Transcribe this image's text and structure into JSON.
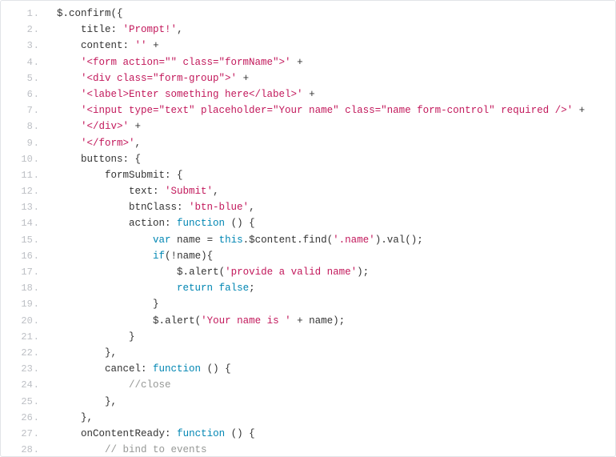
{
  "code": {
    "line_count": 28,
    "lines": [
      {
        "indent": 0,
        "tokens": [
          {
            "c": "pln",
            "t": "$"
          },
          {
            "c": "pun",
            "t": "."
          },
          {
            "c": "pln",
            "t": "confirm"
          },
          {
            "c": "pun",
            "t": "({"
          }
        ]
      },
      {
        "indent": 1,
        "tokens": [
          {
            "c": "key",
            "t": "title"
          },
          {
            "c": "pun",
            "t": ": "
          },
          {
            "c": "str",
            "t": "'Prompt!'"
          },
          {
            "c": "pun",
            "t": ","
          }
        ]
      },
      {
        "indent": 1,
        "tokens": [
          {
            "c": "key",
            "t": "content"
          },
          {
            "c": "pun",
            "t": ": "
          },
          {
            "c": "str",
            "t": "''"
          },
          {
            "c": "pun",
            "t": " +"
          }
        ]
      },
      {
        "indent": 1,
        "tokens": [
          {
            "c": "str",
            "t": "'<form action=\"\" class=\"formName\">'"
          },
          {
            "c": "pun",
            "t": " +"
          }
        ]
      },
      {
        "indent": 1,
        "tokens": [
          {
            "c": "str",
            "t": "'<div class=\"form-group\">'"
          },
          {
            "c": "pun",
            "t": " +"
          }
        ]
      },
      {
        "indent": 1,
        "tokens": [
          {
            "c": "str",
            "t": "'<label>Enter something here</label>'"
          },
          {
            "c": "pun",
            "t": " +"
          }
        ]
      },
      {
        "indent": 1,
        "tokens": [
          {
            "c": "str",
            "t": "'<input type=\"text\" placeholder=\"Your name\" class=\"name form-control\" required />'"
          },
          {
            "c": "pun",
            "t": " +"
          }
        ]
      },
      {
        "indent": 1,
        "tokens": [
          {
            "c": "str",
            "t": "'</div>'"
          },
          {
            "c": "pun",
            "t": " +"
          }
        ]
      },
      {
        "indent": 1,
        "tokens": [
          {
            "c": "str",
            "t": "'</form>'"
          },
          {
            "c": "pun",
            "t": ","
          }
        ]
      },
      {
        "indent": 1,
        "tokens": [
          {
            "c": "key",
            "t": "buttons"
          },
          {
            "c": "pun",
            "t": ": {"
          }
        ]
      },
      {
        "indent": 2,
        "tokens": [
          {
            "c": "key",
            "t": "formSubmit"
          },
          {
            "c": "pun",
            "t": ": {"
          }
        ]
      },
      {
        "indent": 3,
        "tokens": [
          {
            "c": "key",
            "t": "text"
          },
          {
            "c": "pun",
            "t": ": "
          },
          {
            "c": "str",
            "t": "'Submit'"
          },
          {
            "c": "pun",
            "t": ","
          }
        ]
      },
      {
        "indent": 3,
        "tokens": [
          {
            "c": "key",
            "t": "btnClass"
          },
          {
            "c": "pun",
            "t": ": "
          },
          {
            "c": "str",
            "t": "'btn-blue'"
          },
          {
            "c": "pun",
            "t": ","
          }
        ]
      },
      {
        "indent": 3,
        "tokens": [
          {
            "c": "key",
            "t": "action"
          },
          {
            "c": "pun",
            "t": ": "
          },
          {
            "c": "kw",
            "t": "function"
          },
          {
            "c": "pun",
            "t": " () {"
          }
        ]
      },
      {
        "indent": 4,
        "tokens": [
          {
            "c": "kw",
            "t": "var"
          },
          {
            "c": "pln",
            "t": " name "
          },
          {
            "c": "pun",
            "t": "= "
          },
          {
            "c": "kw",
            "t": "this"
          },
          {
            "c": "pun",
            "t": "."
          },
          {
            "c": "pln",
            "t": "$content"
          },
          {
            "c": "pun",
            "t": "."
          },
          {
            "c": "pln",
            "t": "find"
          },
          {
            "c": "pun",
            "t": "("
          },
          {
            "c": "str",
            "t": "'.name'"
          },
          {
            "c": "pun",
            "t": ")."
          },
          {
            "c": "pln",
            "t": "val"
          },
          {
            "c": "pun",
            "t": "();"
          }
        ]
      },
      {
        "indent": 4,
        "tokens": [
          {
            "c": "kw",
            "t": "if"
          },
          {
            "c": "pun",
            "t": "(!"
          },
          {
            "c": "pln",
            "t": "name"
          },
          {
            "c": "pun",
            "t": "){"
          }
        ]
      },
      {
        "indent": 5,
        "tokens": [
          {
            "c": "pln",
            "t": "$"
          },
          {
            "c": "pun",
            "t": "."
          },
          {
            "c": "pln",
            "t": "alert"
          },
          {
            "c": "pun",
            "t": "("
          },
          {
            "c": "str",
            "t": "'provide a valid name'"
          },
          {
            "c": "pun",
            "t": ");"
          }
        ]
      },
      {
        "indent": 5,
        "tokens": [
          {
            "c": "kw",
            "t": "return"
          },
          {
            "c": "pln",
            "t": " "
          },
          {
            "c": "kw",
            "t": "false"
          },
          {
            "c": "pun",
            "t": ";"
          }
        ]
      },
      {
        "indent": 4,
        "tokens": [
          {
            "c": "pun",
            "t": "}"
          }
        ]
      },
      {
        "indent": 4,
        "tokens": [
          {
            "c": "pln",
            "t": "$"
          },
          {
            "c": "pun",
            "t": "."
          },
          {
            "c": "pln",
            "t": "alert"
          },
          {
            "c": "pun",
            "t": "("
          },
          {
            "c": "str",
            "t": "'Your name is '"
          },
          {
            "c": "pun",
            "t": " + "
          },
          {
            "c": "pln",
            "t": "name"
          },
          {
            "c": "pun",
            "t": ");"
          }
        ]
      },
      {
        "indent": 3,
        "tokens": [
          {
            "c": "pun",
            "t": "}"
          }
        ]
      },
      {
        "indent": 2,
        "tokens": [
          {
            "c": "pun",
            "t": "},"
          }
        ]
      },
      {
        "indent": 2,
        "tokens": [
          {
            "c": "key",
            "t": "cancel"
          },
          {
            "c": "pun",
            "t": ": "
          },
          {
            "c": "kw",
            "t": "function"
          },
          {
            "c": "pun",
            "t": " () {"
          }
        ]
      },
      {
        "indent": 3,
        "tokens": [
          {
            "c": "cmt",
            "t": "//close"
          }
        ]
      },
      {
        "indent": 2,
        "tokens": [
          {
            "c": "pun",
            "t": "},"
          }
        ]
      },
      {
        "indent": 1,
        "tokens": [
          {
            "c": "pun",
            "t": "},"
          }
        ]
      },
      {
        "indent": 1,
        "tokens": [
          {
            "c": "key",
            "t": "onContentReady"
          },
          {
            "c": "pun",
            "t": ": "
          },
          {
            "c": "kw",
            "t": "function"
          },
          {
            "c": "pun",
            "t": " () {"
          }
        ]
      },
      {
        "indent": 2,
        "tokens": [
          {
            "c": "cmt",
            "t": "// bind to events"
          }
        ]
      }
    ]
  },
  "indent_unit": "    "
}
